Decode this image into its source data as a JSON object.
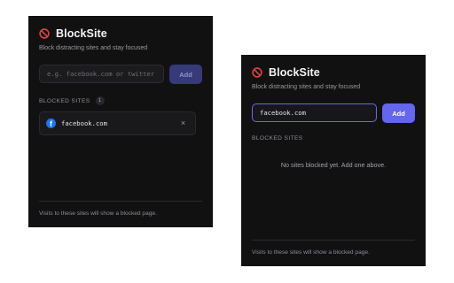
{
  "app": {
    "title": "BlockSite",
    "subtitle": "Block distracting sites and stay focused",
    "logo_icon": "no-entry-icon",
    "accent": "#6466ee",
    "danger": "#e0443a"
  },
  "left_panel": {
    "input": {
      "placeholder": "e.g. facebook.com or twitter"
    },
    "add_label": "Add",
    "section_label": "BLOCKED SITES",
    "count": "1",
    "sites": [
      {
        "name": "facebook.com",
        "icon": "facebook-icon",
        "remove_icon": "close-icon",
        "remove_glyph": "×"
      }
    ],
    "footer": "Visits to these sites will show a blocked page."
  },
  "right_panel": {
    "input": {
      "value": "facebook.com"
    },
    "add_label": "Add",
    "section_label": "BLOCKED SITES",
    "empty_message": "No sites blocked yet. Add one above.",
    "footer": "Visits to these sites will show a blocked page."
  }
}
